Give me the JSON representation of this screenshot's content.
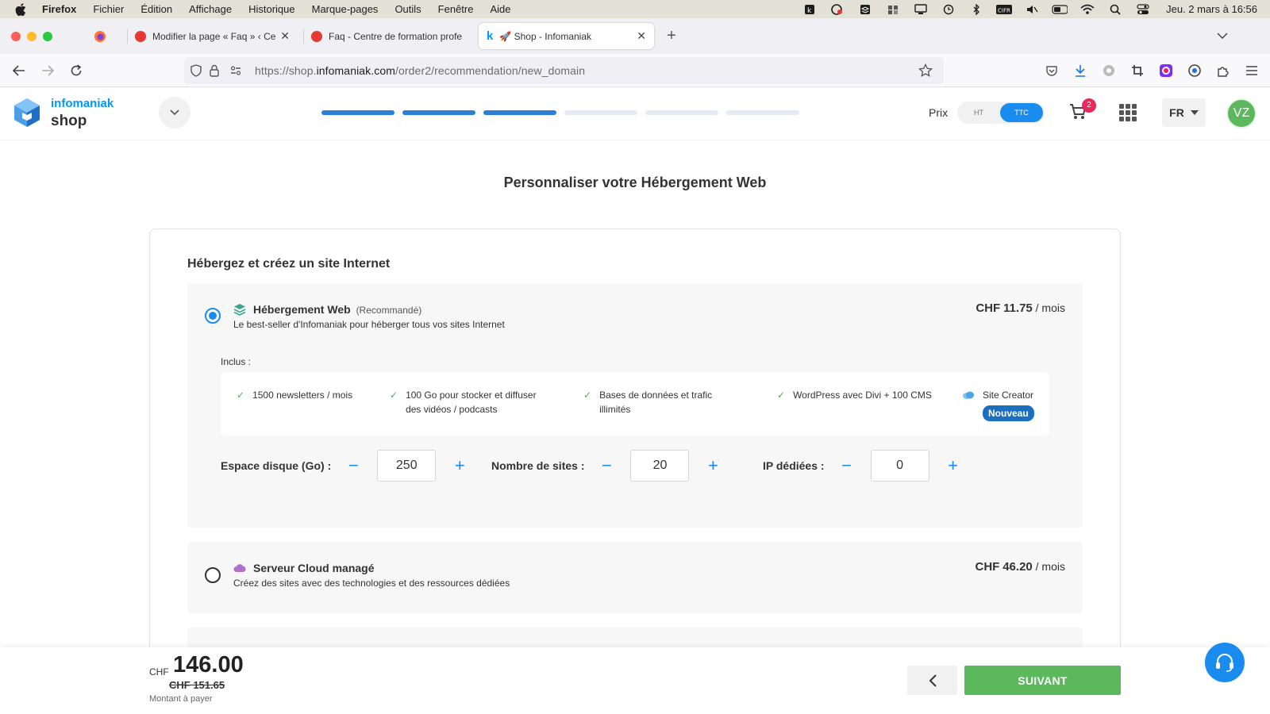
{
  "menubar": {
    "items": [
      "Firefox",
      "Fichier",
      "Édition",
      "Affichage",
      "Historique",
      "Marque-pages",
      "Outils",
      "Fenêtre",
      "Aide"
    ],
    "clock": "Jeu. 2 mars à 16:56"
  },
  "tabs": [
    {
      "label": "Modifier la page « Faq » ‹ Centr",
      "favicon_color": "#e53935"
    },
    {
      "label": "Faq - Centre de formation profe",
      "favicon_color": "#e53935"
    },
    {
      "label": "🚀 Shop - Infomaniak",
      "favicon_color": "#0098ff",
      "active": true
    }
  ],
  "url": {
    "prefix": "https://shop.",
    "host": "infomaniak.com",
    "path": "/order2/recommendation/new_domain"
  },
  "header": {
    "brand_top": "infomaniak",
    "brand_bottom": "shop",
    "steps_total": 6,
    "steps_done": 3,
    "price_label": "Prix",
    "toggle_ht": "HT",
    "toggle_ttc": "TTC",
    "cart_count": "2",
    "lang": "FR",
    "avatar": "VZ"
  },
  "page": {
    "title": "Personnaliser votre Hébergement Web",
    "section_title": "Hébergez et créez un site Internet"
  },
  "options": [
    {
      "name": "Hébergement Web",
      "tag": "(Recommandé)",
      "desc": "Le best-seller d'Infomaniak pour héberger tous vos sites Internet",
      "price_currency": "CHF",
      "price_value": "11.75",
      "price_period": " / mois",
      "selected": true
    },
    {
      "name": "Serveur Cloud managé",
      "desc": "Créez des sites avec des technologies et des ressources dédiées",
      "price_currency": "CHF",
      "price_value": "46.20",
      "price_period": " / mois",
      "selected": false
    }
  ],
  "included": {
    "label": "Inclus :",
    "features": [
      {
        "l1": "1500 newsletters / mois",
        "l2": ""
      },
      {
        "l1": "100 Go pour stocker et diffuser",
        "l2": "des vidéos / podcasts"
      },
      {
        "l1": "Bases de données et trafic",
        "l2": "illimités"
      },
      {
        "l1": "WordPress avec Divi + 100 CMS",
        "l2": ""
      }
    ],
    "site_creator": "Site Creator",
    "new_badge": "Nouveau"
  },
  "quantities": [
    {
      "label": "Espace disque (Go) :",
      "value": "250"
    },
    {
      "label": "Nombre de sites :",
      "value": "20"
    },
    {
      "label": "IP dédiées :",
      "value": "0"
    }
  ],
  "footer": {
    "currency": "CHF",
    "total": "146.00",
    "old_total": "CHF 151.65",
    "total_label": "Montant à payer",
    "next": "SUIVANT"
  }
}
